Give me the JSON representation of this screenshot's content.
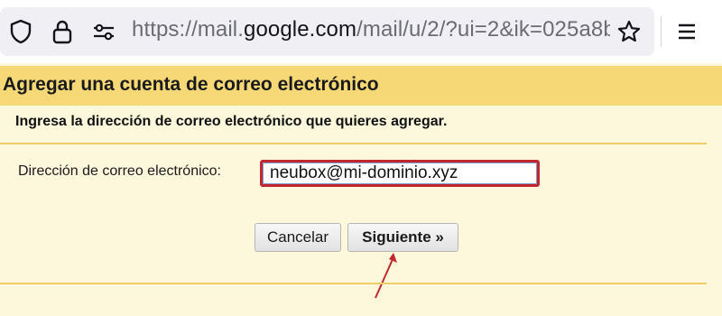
{
  "browser": {
    "url_prefix": "https://mail.",
    "url_domain": "google.com",
    "url_suffix": "/mail/u/2/?ui=2&ik=025a8b",
    "icons": [
      "shield-icon",
      "lock-icon",
      "permissions-icon",
      "star-icon",
      "menu-icon"
    ]
  },
  "dialog": {
    "title": "Agregar una cuenta de correo electrónico",
    "instruction": "Ingresa la dirección de correo electrónico que quieres agregar.",
    "field_label": "Dirección de correo electrónico:",
    "email_value": "neubox@mi-dominio.xyz",
    "cancel_label": "Cancelar",
    "next_label": "Siguiente »"
  },
  "colors": {
    "header_band": "#f6d976",
    "page_background": "#fdf7dc",
    "input_highlight": "#c0282d",
    "arrow": "#c0282d"
  }
}
